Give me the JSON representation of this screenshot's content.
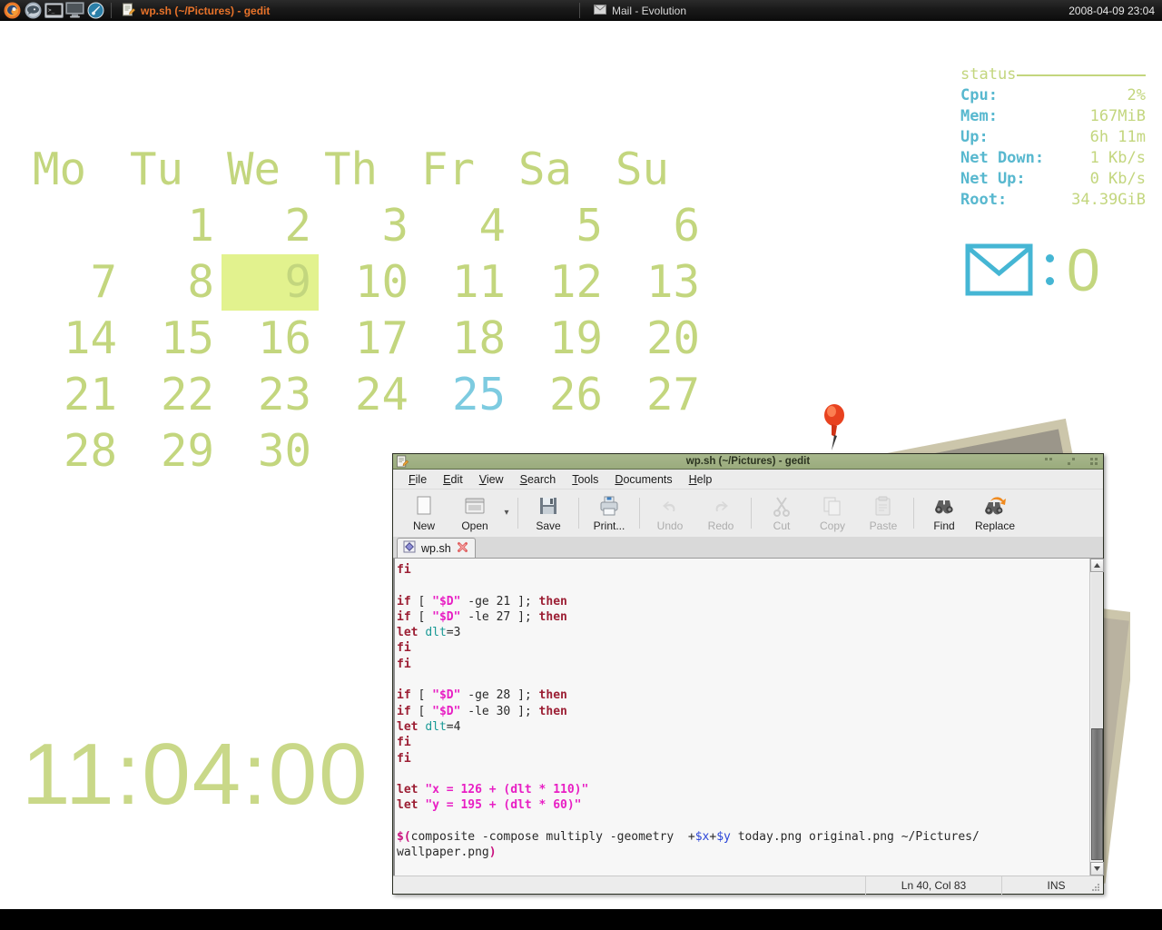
{
  "panel": {
    "launchers": [
      {
        "name": "firefox-icon",
        "label": "Firefox"
      },
      {
        "name": "pidgin-icon",
        "label": "Pidgin"
      },
      {
        "name": "terminal-icon",
        "label": "Terminal"
      },
      {
        "name": "display-icon",
        "label": "Display"
      },
      {
        "name": "rhythmbox-icon",
        "label": "Rhythmbox"
      }
    ],
    "tasks": [
      {
        "name": "task-gedit",
        "label": "wp.sh (~/Pictures) - gedit",
        "icon": "gedit-icon",
        "active": true
      },
      {
        "name": "task-evolution",
        "label": "Mail - Evolution",
        "icon": "mail-icon",
        "active": false
      }
    ],
    "clock": "2008-04-09 23:04"
  },
  "desktop": {
    "clock": "11:04:00",
    "calendar": {
      "weekdays": [
        "Mo",
        "Tu",
        "We",
        "Th",
        "Fr",
        "Sa",
        "Su"
      ],
      "weeks": [
        [
          "",
          "1",
          "2",
          "3",
          "4",
          "5",
          "6"
        ],
        [
          "7",
          "8",
          "9",
          "10",
          "11",
          "12",
          "13"
        ],
        [
          "14",
          "15",
          "16",
          "17",
          "18",
          "19",
          "20"
        ],
        [
          "21",
          "22",
          "23",
          "24",
          "25",
          "26",
          "27"
        ],
        [
          "28",
          "29",
          "30",
          "",
          "",
          "",
          ""
        ]
      ],
      "today": "9",
      "marked": [
        "25"
      ],
      "color_normal": "#c3d67e",
      "color_marked": "#7dcbe0",
      "color_today_bg": "#e2f28e"
    },
    "status": {
      "header": "status",
      "rows": [
        {
          "key": "Cpu:",
          "value": "2%"
        },
        {
          "key": "Mem:",
          "value": "167MiB"
        },
        {
          "key": "Up:",
          "value": "6h 11m"
        },
        {
          "key": "Net Down:",
          "value": "1 Kb/s"
        },
        {
          "key": "Net Up:",
          "value": "0 Kb/s"
        },
        {
          "key": "Root:",
          "value": "34.39GiB"
        }
      ],
      "key_color": "#58b8cf",
      "value_color": "#c3d67e"
    },
    "mail": {
      "icon": "envelope-icon",
      "separator": ":",
      "count": "0"
    }
  },
  "gedit": {
    "title": "wp.sh (~/Pictures) - gedit",
    "window_buttons": [
      {
        "name": "minimize-button",
        "label": "Minimize"
      },
      {
        "name": "maximize-button",
        "label": "Maximize"
      },
      {
        "name": "close-button",
        "label": "Close"
      }
    ],
    "menu": [
      {
        "label": "File",
        "mnemonic": "F"
      },
      {
        "label": "Edit",
        "mnemonic": "E"
      },
      {
        "label": "View",
        "mnemonic": "V"
      },
      {
        "label": "Search",
        "mnemonic": "S"
      },
      {
        "label": "Tools",
        "mnemonic": "T"
      },
      {
        "label": "Documents",
        "mnemonic": "D"
      },
      {
        "label": "Help",
        "mnemonic": "H"
      }
    ],
    "toolbar": [
      {
        "label": "New",
        "icon": "new-document-icon",
        "enabled": true
      },
      {
        "label": "Open",
        "icon": "open-folder-icon",
        "enabled": true
      },
      {
        "label": "Save",
        "icon": "save-disk-icon",
        "enabled": true
      },
      {
        "label": "Print...",
        "icon": "printer-icon",
        "enabled": true
      },
      {
        "label": "Undo",
        "icon": "undo-arrow-icon",
        "enabled": false
      },
      {
        "label": "Redo",
        "icon": "redo-arrow-icon",
        "enabled": false
      },
      {
        "label": "Cut",
        "icon": "scissors-icon",
        "enabled": false
      },
      {
        "label": "Copy",
        "icon": "copy-pages-icon",
        "enabled": false
      },
      {
        "label": "Paste",
        "icon": "clipboard-icon",
        "enabled": false
      },
      {
        "label": "Find",
        "icon": "binoculars-icon",
        "enabled": true
      },
      {
        "label": "Replace",
        "icon": "binoculars-replace-icon",
        "enabled": true
      }
    ],
    "tab": {
      "label": "wp.sh",
      "icon": "script-file-icon",
      "close": "close-tab-icon"
    },
    "statusbar": {
      "position": "Ln 40, Col 83",
      "mode": "INS"
    },
    "code_lines": [
      [
        {
          "t": "k",
          "x": "fi"
        }
      ],
      [],
      [
        {
          "t": "k",
          "x": "if"
        },
        {
          "t": "t",
          "x": " [ "
        },
        {
          "t": "s",
          "x": "\"$D\""
        },
        {
          "t": "t",
          "x": " -ge 21 ]; "
        },
        {
          "t": "k",
          "x": "then"
        }
      ],
      [
        {
          "t": "k",
          "x": "if"
        },
        {
          "t": "t",
          "x": " [ "
        },
        {
          "t": "s",
          "x": "\"$D\""
        },
        {
          "t": "t",
          "x": " -le 27 ]; "
        },
        {
          "t": "k",
          "x": "then"
        }
      ],
      [
        {
          "t": "k",
          "x": "let"
        },
        {
          "t": "t",
          "x": " "
        },
        {
          "t": "v",
          "x": "dlt"
        },
        {
          "t": "t",
          "x": "=3"
        }
      ],
      [
        {
          "t": "k",
          "x": "fi"
        }
      ],
      [
        {
          "t": "k",
          "x": "fi"
        }
      ],
      [],
      [
        {
          "t": "k",
          "x": "if"
        },
        {
          "t": "t",
          "x": " [ "
        },
        {
          "t": "s",
          "x": "\"$D\""
        },
        {
          "t": "t",
          "x": " -ge 28 ]; "
        },
        {
          "t": "k",
          "x": "then"
        }
      ],
      [
        {
          "t": "k",
          "x": "if"
        },
        {
          "t": "t",
          "x": " [ "
        },
        {
          "t": "s",
          "x": "\"$D\""
        },
        {
          "t": "t",
          "x": " -le 30 ]; "
        },
        {
          "t": "k",
          "x": "then"
        }
      ],
      [
        {
          "t": "k",
          "x": "let"
        },
        {
          "t": "t",
          "x": " "
        },
        {
          "t": "v",
          "x": "dlt"
        },
        {
          "t": "t",
          "x": "=4"
        }
      ],
      [
        {
          "t": "k",
          "x": "fi"
        }
      ],
      [
        {
          "t": "k",
          "x": "fi"
        }
      ],
      [],
      [
        {
          "t": "k",
          "x": "let"
        },
        {
          "t": "t",
          "x": " "
        },
        {
          "t": "s",
          "x": "\"x = 126 + (dlt * 110)\""
        }
      ],
      [
        {
          "t": "k",
          "x": "let"
        },
        {
          "t": "t",
          "x": " "
        },
        {
          "t": "s",
          "x": "\"y = 195 + (dlt * 60)\""
        }
      ],
      [],
      [
        {
          "t": "p",
          "x": "$("
        },
        {
          "t": "t",
          "x": "composite -compose multiply -geometry  +"
        },
        {
          "t": "vb",
          "x": "$x"
        },
        {
          "t": "t",
          "x": "+"
        },
        {
          "t": "vb",
          "x": "$y"
        },
        {
          "t": "t",
          "x": " today.png original.png ~/Pictures/"
        }
      ],
      [
        {
          "t": "t",
          "x": "wallpaper.png"
        },
        {
          "t": "p",
          "x": ")"
        }
      ]
    ]
  }
}
